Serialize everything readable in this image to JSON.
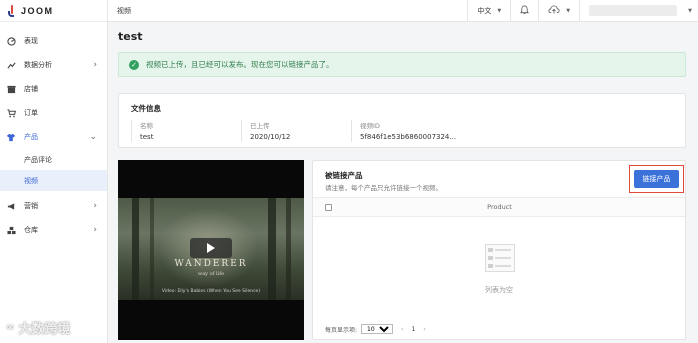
{
  "brand": {
    "name": "JOOM"
  },
  "topbar": {
    "breadcrumb": "视频",
    "language": "中文"
  },
  "sidebar": {
    "items": [
      {
        "label": "表现",
        "icon": "dashboard-icon"
      },
      {
        "label": "数据分析",
        "icon": "analytics-icon",
        "expandable": true
      },
      {
        "label": "店铺",
        "icon": "store-icon"
      },
      {
        "label": "订单",
        "icon": "cart-icon"
      },
      {
        "label": "产品",
        "icon": "shirt-icon",
        "expanded": true,
        "active": true
      },
      {
        "label": "营销",
        "icon": "megaphone-icon",
        "expandable": true
      },
      {
        "label": "仓库",
        "icon": "warehouse-icon",
        "expandable": true
      }
    ],
    "subitems": [
      {
        "label": "产品评论"
      },
      {
        "label": "视频",
        "selected": true
      }
    ]
  },
  "page": {
    "title": "test",
    "alert": "视频已上传，且已经可以发布。现在您可以链接产品了。"
  },
  "file_info": {
    "title": "文件信息",
    "fields": [
      {
        "label": "名称",
        "value": "test"
      },
      {
        "label": "已上传",
        "value": "2020/10/12"
      },
      {
        "label": "视频ID",
        "value": "5f846f1e53b6860007324..."
      }
    ]
  },
  "video": {
    "title": "WANDERER",
    "subtitle": "way of life",
    "credit": "Video: Elly's Babies (When You See Silence)"
  },
  "linked_products": {
    "title": "被链接产品",
    "note": "请注意，每个产品只允许链接一个视频。",
    "button": "链接产品",
    "column_product": "Product",
    "empty": "列表为空",
    "per_page_label": "每页显示项:",
    "per_page_value": "10",
    "current_page": "1"
  },
  "watermark": "大数跨境",
  "colors": {
    "accent": "#3b72d9",
    "success_bg": "#e6f5ec",
    "success": "#32a05f",
    "highlight_border": "#e04a3a"
  }
}
